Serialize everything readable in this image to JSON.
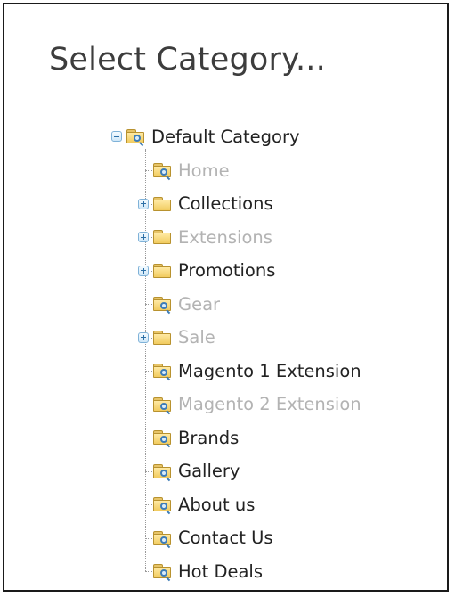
{
  "dialog": {
    "title": "Select Category..."
  },
  "tree": {
    "root": {
      "label": "Default Category",
      "expanded": true,
      "icon": "folder-magnifier-icon"
    },
    "children": [
      {
        "label": "Home",
        "enabled": false,
        "has_children": false
      },
      {
        "label": "Collections",
        "enabled": true,
        "has_children": true
      },
      {
        "label": "Extensions",
        "enabled": false,
        "has_children": true
      },
      {
        "label": "Promotions",
        "enabled": true,
        "has_children": true
      },
      {
        "label": "Gear",
        "enabled": false,
        "has_children": false
      },
      {
        "label": "Sale",
        "enabled": false,
        "has_children": true
      },
      {
        "label": "Magento 1 Extension",
        "enabled": true,
        "has_children": false
      },
      {
        "label": "Magento 2 Extension",
        "enabled": false,
        "has_children": false
      },
      {
        "label": "Brands",
        "enabled": true,
        "has_children": false
      },
      {
        "label": "Gallery",
        "enabled": true,
        "has_children": false
      },
      {
        "label": "About us",
        "enabled": true,
        "has_children": false
      },
      {
        "label": "Contact Us",
        "enabled": true,
        "has_children": false
      },
      {
        "label": "Hot Deals",
        "enabled": true,
        "has_children": false
      }
    ]
  },
  "colors": {
    "text": "#222222",
    "disabled_text": "#b3b3b3",
    "title_text": "#3d3d3d",
    "toggle_border": "#7fb2d8",
    "folder": "#f1cb5f",
    "border": "#1a1a1a"
  }
}
